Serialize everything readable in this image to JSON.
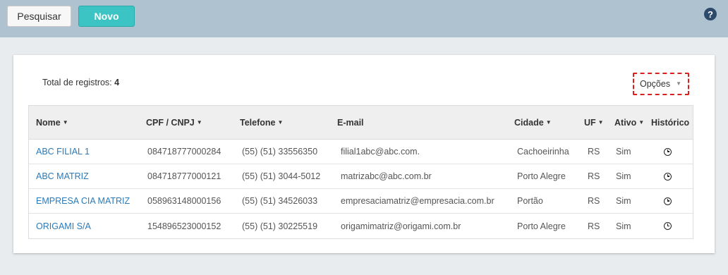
{
  "toolbar": {
    "search_label": "Pesquisar",
    "new_label": "Novo",
    "help_label": "?"
  },
  "summary": {
    "total_label": "Total de registros:",
    "total_value": "4"
  },
  "options": {
    "label": "Opções",
    "caret": "▼"
  },
  "table": {
    "columns": {
      "nome": "Nome",
      "cpf": "CPF / CNPJ",
      "telefone": "Telefone",
      "email": "E-mail",
      "cidade": "Cidade",
      "uf": "UF",
      "ativo": "Ativo",
      "historico": "Histórico"
    },
    "sort_glyph": "▼",
    "rows": [
      {
        "nome": "ABC FILIAL 1",
        "cpf": "084718777000284",
        "telefone": "(55) (51) 33556350",
        "email": "filial1abc@abc.com.",
        "cidade": "Cachoeirinha",
        "uf": "RS",
        "ativo": "Sim"
      },
      {
        "nome": "ABC MATRIZ",
        "cpf": "084718777000121",
        "telefone": "(55) (51) 3044-5012",
        "email": "matrizabc@abc.com.br",
        "cidade": "Porto Alegre",
        "uf": "RS",
        "ativo": "Sim"
      },
      {
        "nome": "EMPRESA CIA MATRIZ",
        "cpf": "058963148000156",
        "telefone": "(55) (51) 34526033",
        "email": "empresaciamatriz@empresacia.com.br",
        "cidade": "Portão",
        "uf": "RS",
        "ativo": "Sim"
      },
      {
        "nome": "ORIGAMI S/A",
        "cpf": "154896523000152",
        "telefone": "(55) (51) 30225519",
        "email": "origamimatriz@origami.com.br",
        "cidade": "Porto Alegre",
        "uf": "RS",
        "ativo": "Sim"
      }
    ]
  },
  "icons": {
    "help": "question-circle-icon",
    "history": "history-clock-icon",
    "sort": "sort-caret-icon"
  },
  "colors": {
    "topbar": "#aec2cf",
    "accent_new": "#3cc4c4",
    "link": "#2a7ab8",
    "highlight_border": "#d9201f"
  }
}
